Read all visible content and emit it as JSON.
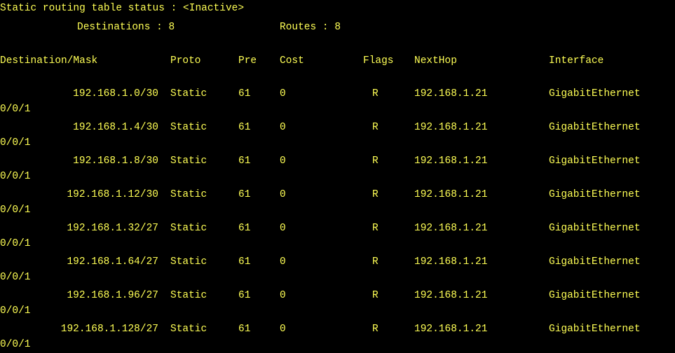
{
  "status_line": "Static routing table status : <Inactive>",
  "summary": {
    "destinations_text": "Destinations : 8",
    "routes_text": "Routes : 8"
  },
  "headers": {
    "destination": "Destination/Mask",
    "proto": "Proto",
    "pre": "Pre",
    "cost": "Cost",
    "flags": "Flags",
    "nexthop": "NextHop",
    "interface": "Interface"
  },
  "routes": [
    {
      "destination": "192.168.1.0/30",
      "proto": "Static",
      "pre": "61",
      "cost": "0",
      "flags": "R",
      "nexthop": "192.168.1.21",
      "interface": "GigabitEthernet",
      "interface_cont": "0/0/1"
    },
    {
      "destination": "192.168.1.4/30",
      "proto": "Static",
      "pre": "61",
      "cost": "0",
      "flags": "R",
      "nexthop": "192.168.1.21",
      "interface": "GigabitEthernet",
      "interface_cont": "0/0/1"
    },
    {
      "destination": "192.168.1.8/30",
      "proto": "Static",
      "pre": "61",
      "cost": "0",
      "flags": "R",
      "nexthop": "192.168.1.21",
      "interface": "GigabitEthernet",
      "interface_cont": "0/0/1"
    },
    {
      "destination": "192.168.1.12/30",
      "proto": "Static",
      "pre": "61",
      "cost": "0",
      "flags": "R",
      "nexthop": "192.168.1.21",
      "interface": "GigabitEthernet",
      "interface_cont": "0/0/1"
    },
    {
      "destination": "192.168.1.32/27",
      "proto": "Static",
      "pre": "61",
      "cost": "0",
      "flags": "R",
      "nexthop": "192.168.1.21",
      "interface": "GigabitEthernet",
      "interface_cont": "0/0/1"
    },
    {
      "destination": "192.168.1.64/27",
      "proto": "Static",
      "pre": "61",
      "cost": "0",
      "flags": "R",
      "nexthop": "192.168.1.21",
      "interface": "GigabitEthernet",
      "interface_cont": "0/0/1"
    },
    {
      "destination": "192.168.1.96/27",
      "proto": "Static",
      "pre": "61",
      "cost": "0",
      "flags": "R",
      "nexthop": "192.168.1.21",
      "interface": "GigabitEthernet",
      "interface_cont": "0/0/1"
    },
    {
      "destination": "192.168.1.128/27",
      "proto": "Static",
      "pre": "61",
      "cost": "0",
      "flags": "R",
      "nexthop": "192.168.1.21",
      "interface": "GigabitEthernet",
      "interface_cont": "0/0/1"
    }
  ],
  "colors": {
    "background": "#000000",
    "text": "#ffff55"
  }
}
